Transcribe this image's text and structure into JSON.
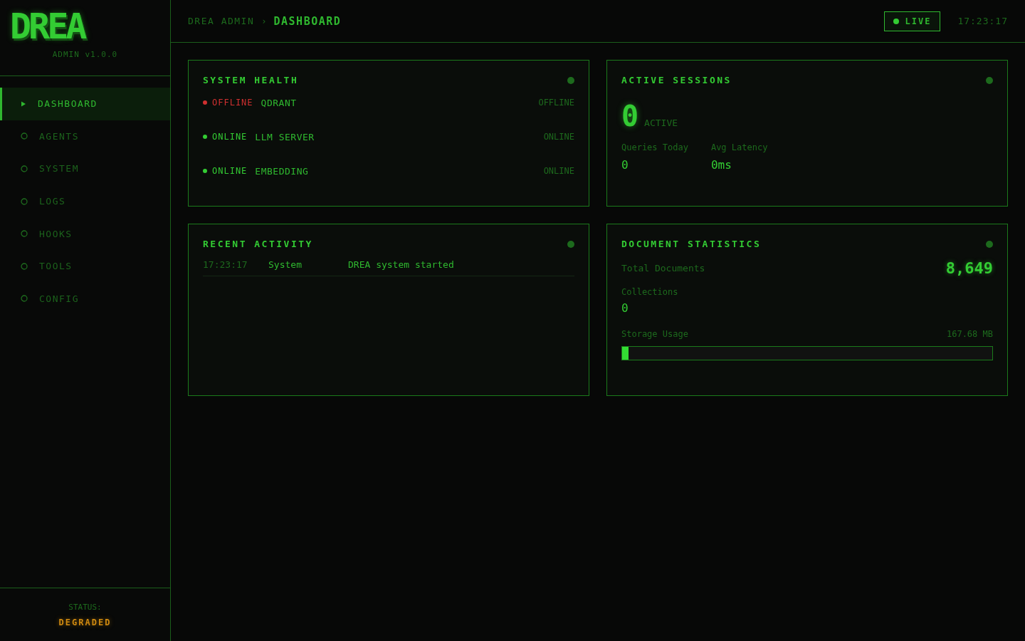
{
  "sidebar": {
    "logo": "DREA",
    "version": "ADMIN v1.0.0",
    "items": [
      {
        "label": "DASHBOARD",
        "selected": true
      },
      {
        "label": "AGENTS",
        "selected": false
      },
      {
        "label": "SYSTEM",
        "selected": false
      },
      {
        "label": "LOGS",
        "selected": false
      },
      {
        "label": "HOOKS",
        "selected": false
      },
      {
        "label": "TOOLS",
        "selected": false
      },
      {
        "label": "CONFIG",
        "selected": false
      }
    ],
    "status_label": "STATUS:",
    "status": {
      "text": "DEGRADED",
      "kind": "degraded"
    }
  },
  "header": {
    "breadcrumb": [
      "DREA ADMIN",
      "DASHBOARD"
    ],
    "separator": "›",
    "live": "LIVE",
    "time": "17:23:17"
  },
  "system_health": {
    "title": "SYSTEM HEALTH",
    "services": [
      {
        "kind": "offline",
        "status": "OFFLINE",
        "name": "QDRANT",
        "state": "OFFLINE"
      },
      {
        "kind": "online",
        "status": "ONLINE",
        "name": "LLM SERVER",
        "state": "ONLINE"
      },
      {
        "kind": "online",
        "status": "ONLINE",
        "name": "EMBEDDING",
        "state": "ONLINE"
      }
    ]
  },
  "active_sessions": {
    "title": "ACTIVE SESSIONS",
    "count": "0",
    "count_label": "ACTIVE",
    "stats": [
      {
        "label": "Queries Today",
        "value": "0"
      },
      {
        "label": "Avg Latency",
        "value": "0ms"
      }
    ]
  },
  "recent_activity": {
    "title": "RECENT ACTIVITY",
    "entries": [
      {
        "time": "17:23:17",
        "source": "System",
        "message": "DREA system started"
      }
    ]
  },
  "document_statistics": {
    "title": "DOCUMENT STATISTICS",
    "total_label": "Total Documents",
    "total": "8,649",
    "collections_label": "Collections",
    "collections": "0",
    "storage_label": "Storage Usage",
    "storage": "167.68 MB",
    "level": 0.017
  }
}
